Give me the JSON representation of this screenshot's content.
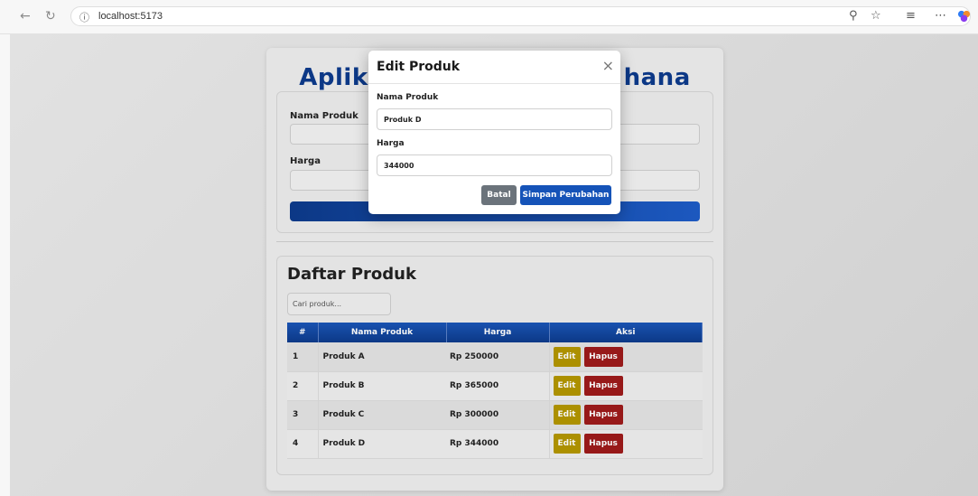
{
  "browser": {
    "url": "localhost:5173",
    "icons": [
      "back-icon",
      "refresh-icon",
      "info-icon",
      "zoom-icon",
      "favorite-icon",
      "collections-icon",
      "more-icon",
      "copilot-icon"
    ]
  },
  "app": {
    "title_left": "Aplik",
    "title_right": "hana",
    "form": {
      "name_label": "Nama Produk",
      "price_label": "Harga"
    }
  },
  "list": {
    "title": "Daftar Produk",
    "search_placeholder": "Cari produk...",
    "columns": [
      "#",
      "Nama Produk",
      "Harga",
      "Aksi"
    ],
    "rows": [
      {
        "no": "1",
        "name": "Produk A",
        "price": "Rp 250000",
        "edit": "Edit",
        "delete": "Hapus"
      },
      {
        "no": "2",
        "name": "Produk B",
        "price": "Rp 365000",
        "edit": "Edit",
        "delete": "Hapus"
      },
      {
        "no": "3",
        "name": "Produk C",
        "price": "Rp 300000",
        "edit": "Edit",
        "delete": "Hapus"
      },
      {
        "no": "4",
        "name": "Produk D",
        "price": "Rp 344000",
        "edit": "Edit",
        "delete": "Hapus"
      }
    ]
  },
  "modal": {
    "title": "Edit Produk",
    "close_symbol": "×",
    "name_label": "Nama Produk",
    "name_value": "Produk D",
    "price_label": "Harga",
    "price_value": "344000",
    "cancel_label": "Batal",
    "save_label": "Simpan Perubahan"
  },
  "colors": {
    "primary": "#0d3b8c",
    "edit_button": "#b39600",
    "delete_button": "#9e1b1b",
    "cancel_button": "#6b737b",
    "save_button": "#1553b8"
  }
}
